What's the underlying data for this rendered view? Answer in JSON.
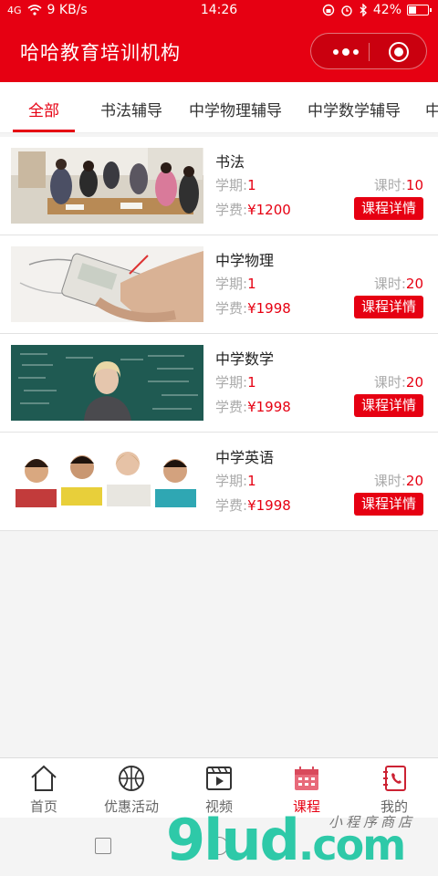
{
  "status_bar": {
    "signal": "4G",
    "speed": "9 KB/s",
    "time": "14:26",
    "battery": "42%",
    "battery_level": 0.42
  },
  "header": {
    "title": "哈哈教育培训机构"
  },
  "tabs": [
    "全部",
    "书法辅导",
    "中学物理辅导",
    "中学数学辅导",
    "中"
  ],
  "courses": [
    {
      "name": "书法",
      "term_label": "学期:",
      "term": "1",
      "hours_label": "课时:",
      "hours": "10",
      "fee_label": "学费:",
      "fee": "¥1200",
      "button": "课程详情",
      "image": "calligraphy-class-photo"
    },
    {
      "name": "中学物理",
      "term_label": "学期:",
      "term": "1",
      "hours_label": "课时:",
      "hours": "20",
      "fee_label": "学费:",
      "fee": "¥1998",
      "button": "课程详情",
      "image": "physics-multimeter-photo"
    },
    {
      "name": "中学数学",
      "term_label": "学期:",
      "term": "1",
      "hours_label": "课时:",
      "hours": "20",
      "fee_label": "学费:",
      "fee": "¥1998",
      "button": "课程详情",
      "image": "math-chalkboard-photo"
    },
    {
      "name": "中学英语",
      "term_label": "学期:",
      "term": "1",
      "hours_label": "课时:",
      "hours": "20",
      "fee_label": "学费:",
      "fee": "¥1998",
      "button": "课程详情",
      "image": "english-students-photo"
    }
  ],
  "bottom_nav": [
    {
      "label": "首页",
      "icon": "home-icon"
    },
    {
      "label": "优惠活动",
      "icon": "basketball-icon"
    },
    {
      "label": "视频",
      "icon": "video-icon"
    },
    {
      "label": "课程",
      "icon": "calendar-icon"
    },
    {
      "label": "我的",
      "icon": "contacts-book-icon"
    }
  ],
  "watermark": {
    "brand": "9lud",
    "domain": ".com",
    "subtitle": "小程序商店"
  },
  "colors": {
    "brand_red": "#e60012",
    "muted_text": "#aaaaaa",
    "watermark_green": "#2ec9a8"
  }
}
